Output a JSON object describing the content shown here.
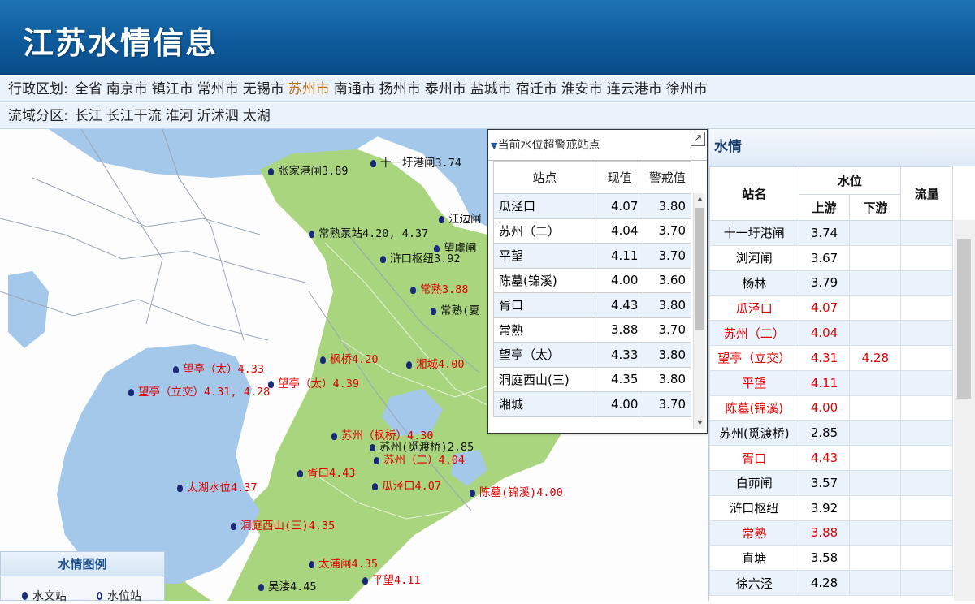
{
  "header": {
    "title": "江苏水情信息"
  },
  "admin_filter": {
    "label": "行政区划:",
    "options": [
      "全省",
      "南京市",
      "镇江市",
      "常州市",
      "无锡市",
      "苏州市",
      "南通市",
      "扬州市",
      "泰州市",
      "盐城市",
      "宿迁市",
      "淮安市",
      "连云港市",
      "徐州市"
    ],
    "active": "苏州市"
  },
  "basin_filter": {
    "label": "流域分区:",
    "options": [
      "长江",
      "长江干流",
      "淮河",
      "沂沭泗",
      "太湖"
    ]
  },
  "map": {
    "markers": [
      {
        "text": "张家港闸3.89",
        "color": "black"
      },
      {
        "text": "十一圩港闸3.74",
        "color": "black"
      },
      {
        "text": "江边闸",
        "color": "black"
      },
      {
        "text": "常熟泵站4.20, 4.37",
        "color": "black"
      },
      {
        "text": "望虞闸",
        "color": "black"
      },
      {
        "text": "浒口枢纽3.92",
        "color": "black"
      },
      {
        "text": "常熟3.88",
        "color": "red"
      },
      {
        "text": "常熟(夏",
        "color": "black"
      },
      {
        "text": "枫桥4.20",
        "color": "red"
      },
      {
        "text": "湘城4.00",
        "color": "red"
      },
      {
        "text": "望亭（太）4.33",
        "color": "red"
      },
      {
        "text": "望亭（太）4.39",
        "color": "red"
      },
      {
        "text": "望亭（立交）4.31, 4.28",
        "color": "red"
      },
      {
        "text": "苏州（枫桥）4.30",
        "color": "red"
      },
      {
        "text": "苏州(觅渡桥)2.85",
        "color": "black"
      },
      {
        "text": "苏州（二）4.04",
        "color": "red"
      },
      {
        "text": "胥口4.43",
        "color": "red"
      },
      {
        "text": "瓜泾口4.07",
        "color": "red"
      },
      {
        "text": "陈墓(锦溪)4.00",
        "color": "red"
      },
      {
        "text": "太湖水位4.37",
        "color": "red"
      },
      {
        "text": "洞庭西山(三)4.35",
        "color": "red"
      },
      {
        "text": "太浦闸4.35",
        "color": "red"
      },
      {
        "text": "平望4.11",
        "color": "red"
      },
      {
        "text": "吴溇4.45",
        "color": "black"
      }
    ]
  },
  "alert": {
    "title": "当前水位超警戒站点",
    "columns": [
      "站点",
      "现值",
      "警戒值"
    ],
    "rows": [
      [
        "瓜泾口",
        "4.07",
        "3.80"
      ],
      [
        "苏州（二）",
        "4.04",
        "3.70"
      ],
      [
        "平望",
        "4.11",
        "3.70"
      ],
      [
        "陈墓(锦溪)",
        "4.00",
        "3.60"
      ],
      [
        "胥口",
        "4.43",
        "3.80"
      ],
      [
        "常熟",
        "3.88",
        "3.70"
      ],
      [
        "望亭（太）",
        "4.33",
        "3.80"
      ],
      [
        "洞庭西山(三)",
        "4.35",
        "3.80"
      ],
      [
        "湘城",
        "4.00",
        "3.70"
      ]
    ]
  },
  "legend": {
    "title": "水情图例",
    "items": [
      "水文站",
      "水位站"
    ]
  },
  "water": {
    "title": "水情",
    "columns": {
      "station": "站名",
      "level": "水位",
      "upstream": "上游",
      "downstream": "下游",
      "flow": "流量"
    },
    "rows": [
      {
        "name": "十一圩港闸",
        "up": "3.74",
        "down": "",
        "flow": "",
        "red": false
      },
      {
        "name": "浏河闸",
        "up": "3.67",
        "down": "",
        "flow": "",
        "red": false
      },
      {
        "name": "杨林",
        "up": "3.79",
        "down": "",
        "flow": "",
        "red": false
      },
      {
        "name": "瓜泾口",
        "up": "4.07",
        "down": "",
        "flow": "",
        "red": true
      },
      {
        "name": "苏州（二）",
        "up": "4.04",
        "down": "",
        "flow": "",
        "red": true
      },
      {
        "name": "望亭（立交）",
        "up": "4.31",
        "down": "4.28",
        "flow": "",
        "red": true
      },
      {
        "name": "平望",
        "up": "4.11",
        "down": "",
        "flow": "",
        "red": true
      },
      {
        "name": "陈墓(锦溪)",
        "up": "4.00",
        "down": "",
        "flow": "",
        "red": true
      },
      {
        "name": "苏州(觅渡桥)",
        "up": "2.85",
        "down": "",
        "flow": "",
        "red": false
      },
      {
        "name": "胥口",
        "up": "4.43",
        "down": "",
        "flow": "",
        "red": true
      },
      {
        "name": "白茆闸",
        "up": "3.57",
        "down": "",
        "flow": "",
        "red": false
      },
      {
        "name": "浒口枢纽",
        "up": "3.92",
        "down": "",
        "flow": "",
        "red": false
      },
      {
        "name": "常熟",
        "up": "3.88",
        "down": "",
        "flow": "",
        "red": true
      },
      {
        "name": "直塘",
        "up": "3.58",
        "down": "",
        "flow": "",
        "red": false
      },
      {
        "name": "徐六泾",
        "up": "4.28",
        "down": "",
        "flow": "",
        "red": false
      }
    ]
  },
  "colors": {
    "header_bg": "#0e5a9a",
    "land": "#a9d57e",
    "water": "#a4c8ea",
    "alert_red": "#e00000",
    "active_filter": "#b8741a"
  }
}
